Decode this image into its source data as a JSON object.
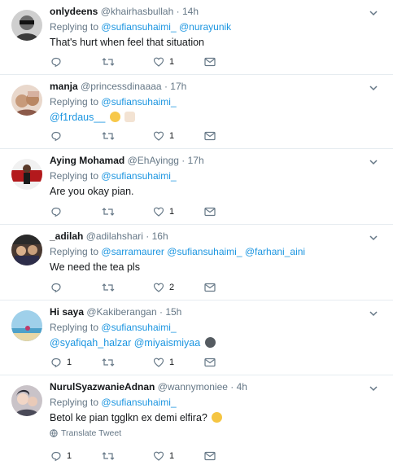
{
  "tweets": [
    {
      "name": "onlydeens",
      "handle": "@khairhasbullah",
      "dot": "·",
      "time": "14h",
      "replying_prefix": "Replying to",
      "replying_to": [
        "@sufiansuhaimi_",
        "@nurayunik"
      ],
      "text": "That's hurt when feel that situation",
      "replies": "",
      "retweets": "",
      "likes": "1"
    },
    {
      "name": "manja",
      "handle": "@princessdinaaaa",
      "dot": "·",
      "time": "17h",
      "replying_prefix": "Replying to",
      "replying_to": [
        "@sufiansuhaimi_"
      ],
      "text_mention": "@f1rdaus__",
      "text": "",
      "replies": "",
      "retweets": "",
      "likes": "1"
    },
    {
      "name": "Aying Mohamad",
      "handle": "@EhAyingg",
      "dot": "·",
      "time": "17h",
      "replying_prefix": "Replying to",
      "replying_to": [
        "@sufiansuhaimi_"
      ],
      "text": "Are you okay pian.",
      "replies": "",
      "retweets": "",
      "likes": "1"
    },
    {
      "name": "_adilah",
      "handle": "@adilahshari",
      "dot": "·",
      "time": "16h",
      "replying_prefix": "Replying to",
      "replying_to": [
        "@sarramaurer",
        "@sufiansuhaimi_",
        "@farhani_aini"
      ],
      "text": "We need the tea pls",
      "replies": "",
      "retweets": "",
      "likes": "2"
    },
    {
      "name": "Hi saya",
      "handle": "@Kakiberangan",
      "dot": "·",
      "time": "15h",
      "replying_prefix": "Replying to",
      "replying_to": [
        "@sufiansuhaimi_"
      ],
      "text_mentions": [
        "@syafiqah_halzar",
        "@miyaismiyaa"
      ],
      "text": "",
      "replies": "1",
      "retweets": "",
      "likes": "1"
    },
    {
      "name": "NurulSyazwanieAdnan",
      "handle": "@wannymoniee",
      "dot": "·",
      "time": "4h",
      "replying_prefix": "Replying to",
      "replying_to": [
        "@sufiansuhaimi_"
      ],
      "text": "Betol ke pian tgglkn ex demi elfira?",
      "translate": "Translate Tweet",
      "replies": "1",
      "retweets": "",
      "likes": "1"
    }
  ],
  "colors": {
    "link": "#1b95e0",
    "muted": "#657786",
    "border": "#e6ecf0",
    "text": "#14171a"
  },
  "icons": [
    "reply-icon",
    "retweet-icon",
    "like-icon",
    "dm-icon",
    "chevron-down-icon",
    "globe-icon"
  ]
}
